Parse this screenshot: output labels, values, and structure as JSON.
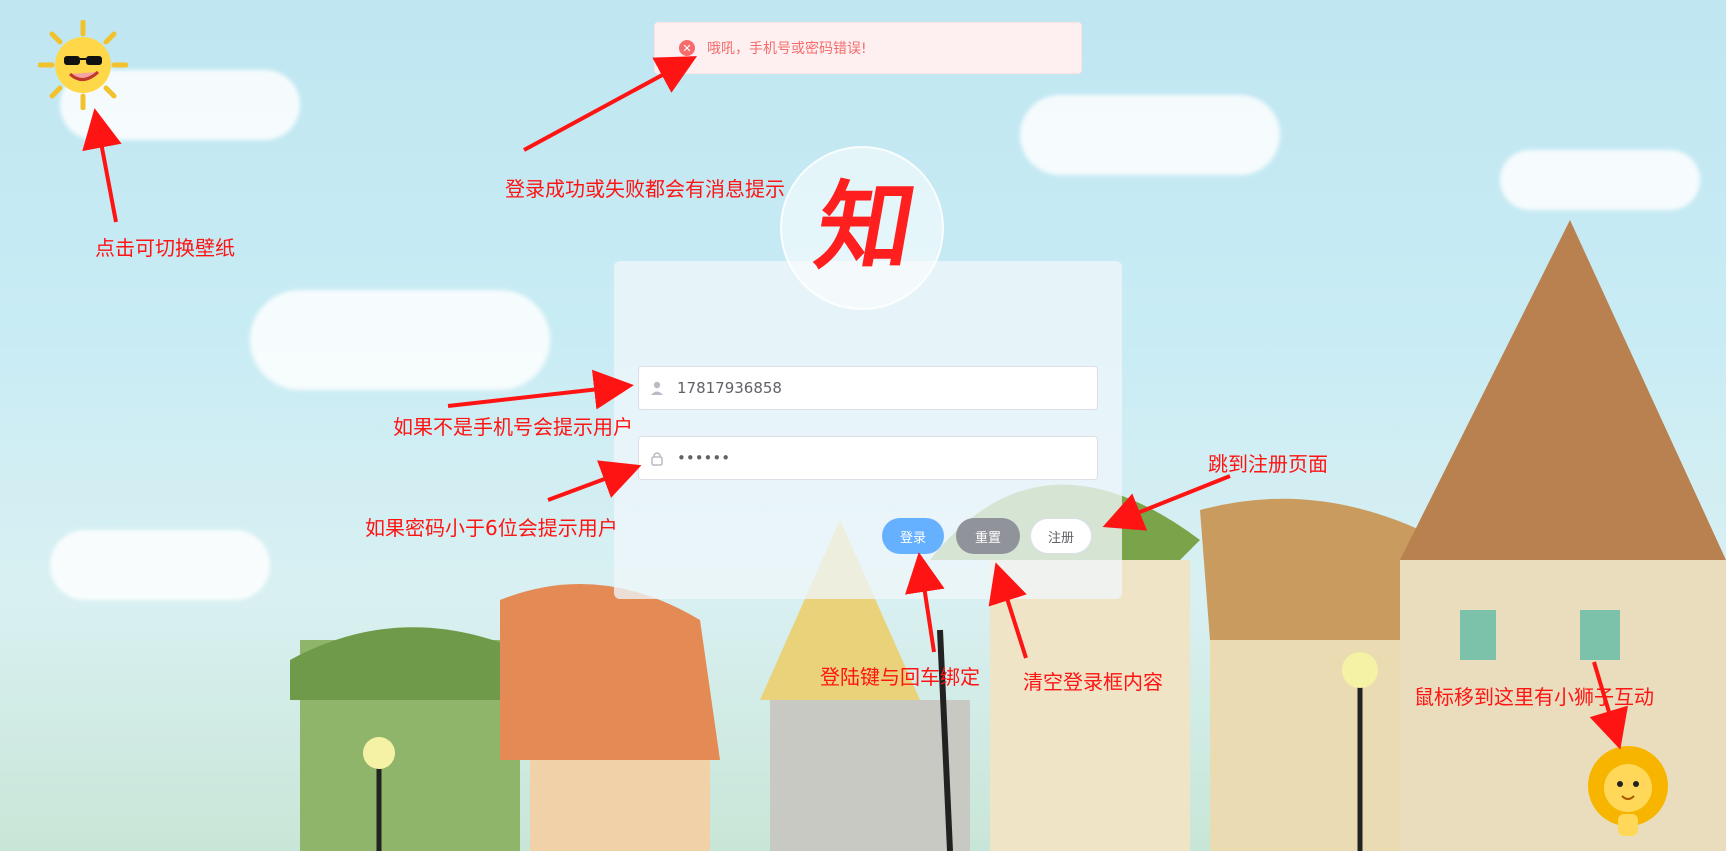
{
  "toast": {
    "message": "哦吼，手机号或密码错误!",
    "icon": "error-circle-icon",
    "color": "#f56c6c",
    "background": "#fef0f0"
  },
  "logo": {
    "glyph": "知",
    "color": "#ff1f1f"
  },
  "form": {
    "phone": {
      "value": "17817936858",
      "icon": "user-icon"
    },
    "password": {
      "value": "••••••",
      "icon": "lock-icon"
    }
  },
  "buttons": {
    "login_label": "登录",
    "reset_label": "重置",
    "register_label": "注册",
    "login_color": "#66b1ff",
    "reset_color": "#909399"
  },
  "annotations": {
    "switch_wallpaper": "点击可切换壁纸",
    "message_tip": "登录成功或失败都会有消息提示",
    "phone_tip": "如果不是手机号会提示用户",
    "password_tip": "如果密码小于6位会提示用户",
    "register_tip": "跳到注册页面",
    "login_tip": "登陆键与回车绑定",
    "reset_tip": "清空登录框内容",
    "lion_tip": "鼠标移到这里有小狮子互动",
    "color": "#ff1414"
  }
}
